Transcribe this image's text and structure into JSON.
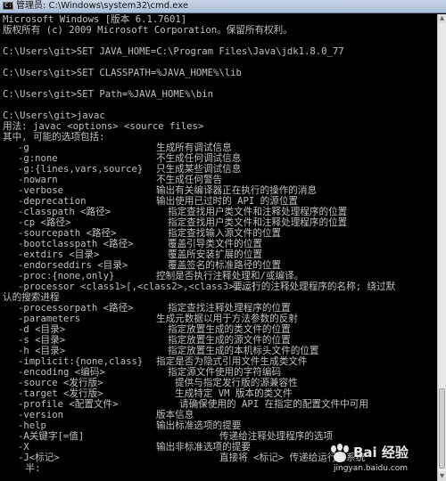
{
  "window": {
    "title": "管理员: C:\\Windows\\system32\\cmd.exe",
    "icon_text": "C:\\"
  },
  "header_lines": [
    "Microsoft Windows [版本 6.1.7601]",
    "版权所有 (c) 2009 Microsoft Corporation。保留所有权利。",
    "",
    "C:\\Users\\git>SET JAVA_HOME=C:\\Program Files\\Java\\jdk1.8.0_77",
    "",
    "C:\\Users\\git>SET CLASSPATH=%JAVA_HOME%\\lib",
    "",
    "C:\\Users\\git>SET Path=%JAVA_HOME%\\bin",
    "",
    "C:\\Users\\git>javac",
    "用法: javac <options> <source files>",
    "其中, 可能的选项包括:"
  ],
  "options": [
    {
      "opt": "-g",
      "desc": "生成所有调试信息",
      "indent": 0
    },
    {
      "opt": "-g:none",
      "desc": "不生成任何调试信息",
      "indent": 0
    },
    {
      "opt": "-g:{lines,vars,source}",
      "desc": "只生成某些调试信息",
      "indent": 0
    },
    {
      "opt": "-nowarn",
      "desc": "不生成任何警告",
      "indent": 0
    },
    {
      "opt": "-verbose",
      "desc": "输出有关编译器正在执行的操作的消息",
      "indent": 0
    },
    {
      "opt": "-deprecation",
      "desc": "输出使用已过时的 API 的源位置",
      "indent": 0
    },
    {
      "opt": "-classpath <路径>",
      "desc": "指定查找用户类文件和注释处理程序的位置",
      "indent": 1
    },
    {
      "opt": "-cp <路径>",
      "desc": "指定查找用户类文件和注释处理程序的位置",
      "indent": 1
    },
    {
      "opt": "-sourcepath <路径>",
      "desc": "指定查找输入源文件的位置",
      "indent": 1
    },
    {
      "opt": "-bootclasspath <路径>",
      "desc": "覆盖引导类文件的位置",
      "indent": 1
    },
    {
      "opt": "-extdirs <目录>",
      "desc": "覆盖所安装扩展的位置",
      "indent": 1
    },
    {
      "opt": "-endorseddirs <目录>",
      "desc": "覆盖签名的标准路径的位置",
      "indent": 1
    },
    {
      "opt": "-proc:{none,only}",
      "desc": "控制是否执行注释处理和/或编译。",
      "indent": 0
    },
    {
      "opt": "-processor <class1>[,<class2>,<class3>...]",
      "desc": "要运行的注释处理程序的名称; 绕过默",
      "indent": 2
    },
    {
      "opt": "",
      "desc": "",
      "indent": 0,
      "full": "认的搜索进程"
    },
    {
      "opt": "-processorpath <路径>",
      "desc": "指定查找注释处理程序的位置",
      "indent": 1
    },
    {
      "opt": "-parameters",
      "desc": "生成元数据以用于方法参数的反射",
      "indent": 0
    },
    {
      "opt": "-d <目录>",
      "desc": "指定放置生成的类文件的位置",
      "indent": 1
    },
    {
      "opt": "-s <目录>",
      "desc": "指定放置生成的源文件的位置",
      "indent": 1
    },
    {
      "opt": "-h <目录>",
      "desc": "指定放置生成的本机标头文件的位置",
      "indent": 1
    },
    {
      "opt": "-implicit:{none,class}",
      "desc": "指定是否为隐式引用文件生成类文件",
      "indent": 0
    },
    {
      "opt": "-encoding <编码>",
      "desc": "指定源文件使用的字符编码",
      "indent": 1
    },
    {
      "opt": "-source <发行版>",
      "desc": "提供与指定发行版的源兼容性",
      "indent": 3
    },
    {
      "opt": "-target <发行版>",
      "desc": "生成特定 VM 版本的类文件",
      "indent": 3
    },
    {
      "opt": "-profile <配置文件>",
      "desc": "请确保使用的 API 在指定的配置文件中可用",
      "indent": 4
    },
    {
      "opt": "-version",
      "desc": "版本信息",
      "indent": 0
    },
    {
      "opt": "-help",
      "desc": "输出标准选项的提要",
      "indent": 0
    },
    {
      "opt": "-A关键字[=值]",
      "desc": "传递给注释处理程序的选项",
      "indent": 2
    },
    {
      "opt": "-X",
      "desc": "输出非标准选项的提要",
      "indent": 0
    },
    {
      "opt": "-J<标记>",
      "desc": "直接将 <标记> 传递给运行时系统",
      "indent": 2
    },
    {
      "opt": "",
      "desc": "",
      "indent": 0,
      "full": "    半:"
    }
  ],
  "watermark": {
    "brand": "Bai 经验",
    "url": "jingyan.baidu.com"
  }
}
